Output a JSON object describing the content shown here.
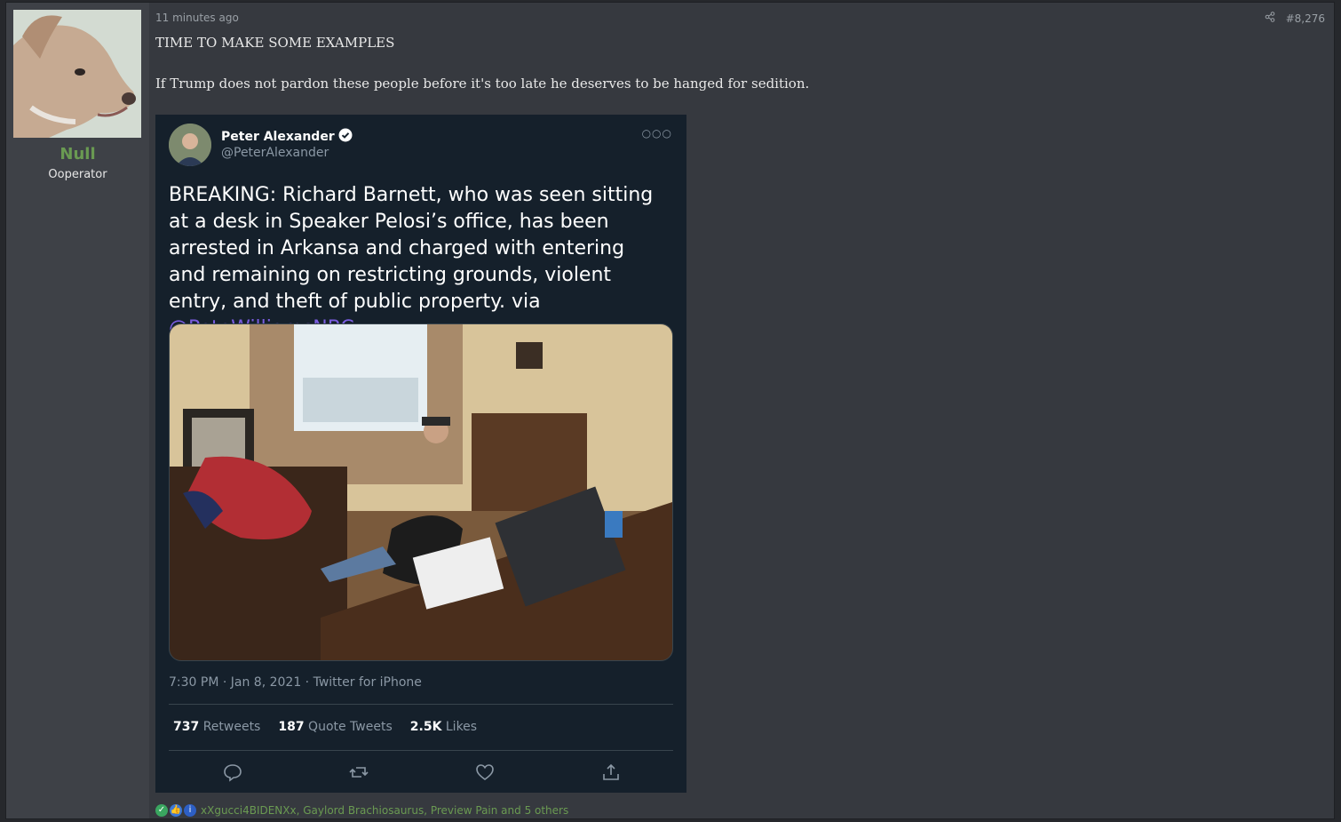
{
  "user": {
    "name": "Null",
    "title": "Ooperator"
  },
  "post": {
    "time": "11 minutes ago",
    "number": "#8,276",
    "line1": "TIME TO MAKE SOME EXAMPLES",
    "line2": "If Trump does not pardon these people before it's too late he deserves to be hanged for sedition."
  },
  "tweet": {
    "name": "Peter Alexander",
    "handle": "@PeterAlexander",
    "text": "BREAKING: Richard Barnett, who was seen sitting at a desk in Speaker Pelosi’s office, has been arrested in Arkansa and charged with entering and remaining on restricting grounds, violent entry, and theft of public property. via ",
    "mention": "@PeteWilliamsNBC",
    "date": "7:30 PM · Jan 8, 2021 · Twitter for iPhone",
    "retweets_count": "737",
    "retweets_label": "Retweets",
    "quotes_count": "187",
    "quotes_label": "Quote Tweets",
    "likes_count": "2.5K",
    "likes_label": "Likes"
  },
  "reactions": {
    "text": "xXgucci4BIDENXx, Gaylord Brachiosaurus, Preview Pain and 5 others"
  },
  "colors": {
    "username": "#6a9a52",
    "mention": "#7a5de0"
  }
}
